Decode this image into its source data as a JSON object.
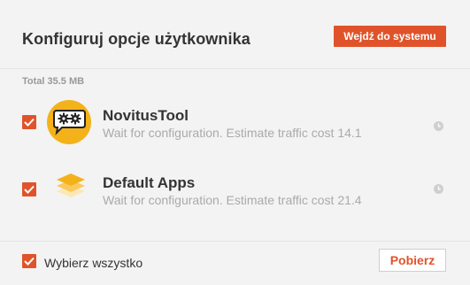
{
  "header": {
    "title": "Konfiguruj opcje użytkownika",
    "enter_button": "Wejdź do systemu"
  },
  "total": "Total 35.5 MB",
  "apps": [
    {
      "name": "NovitusTool",
      "description": "Wait for configuration. Estimate traffic cost 14.1",
      "icon": "gears-chat-icon",
      "checked": true
    },
    {
      "name": "Default Apps",
      "description": "Wait for configuration. Estimate traffic cost 21.4",
      "icon": "layers-icon",
      "checked": true
    }
  ],
  "footer": {
    "select_all_label": "Wybierz wszystko",
    "select_all_checked": true,
    "download_button": "Pobierz"
  },
  "colors": {
    "accent": "#e0532a",
    "icon_yellow": "#f4b21a",
    "muted_text": "#aaaaaa",
    "background": "#f3f3f3"
  }
}
